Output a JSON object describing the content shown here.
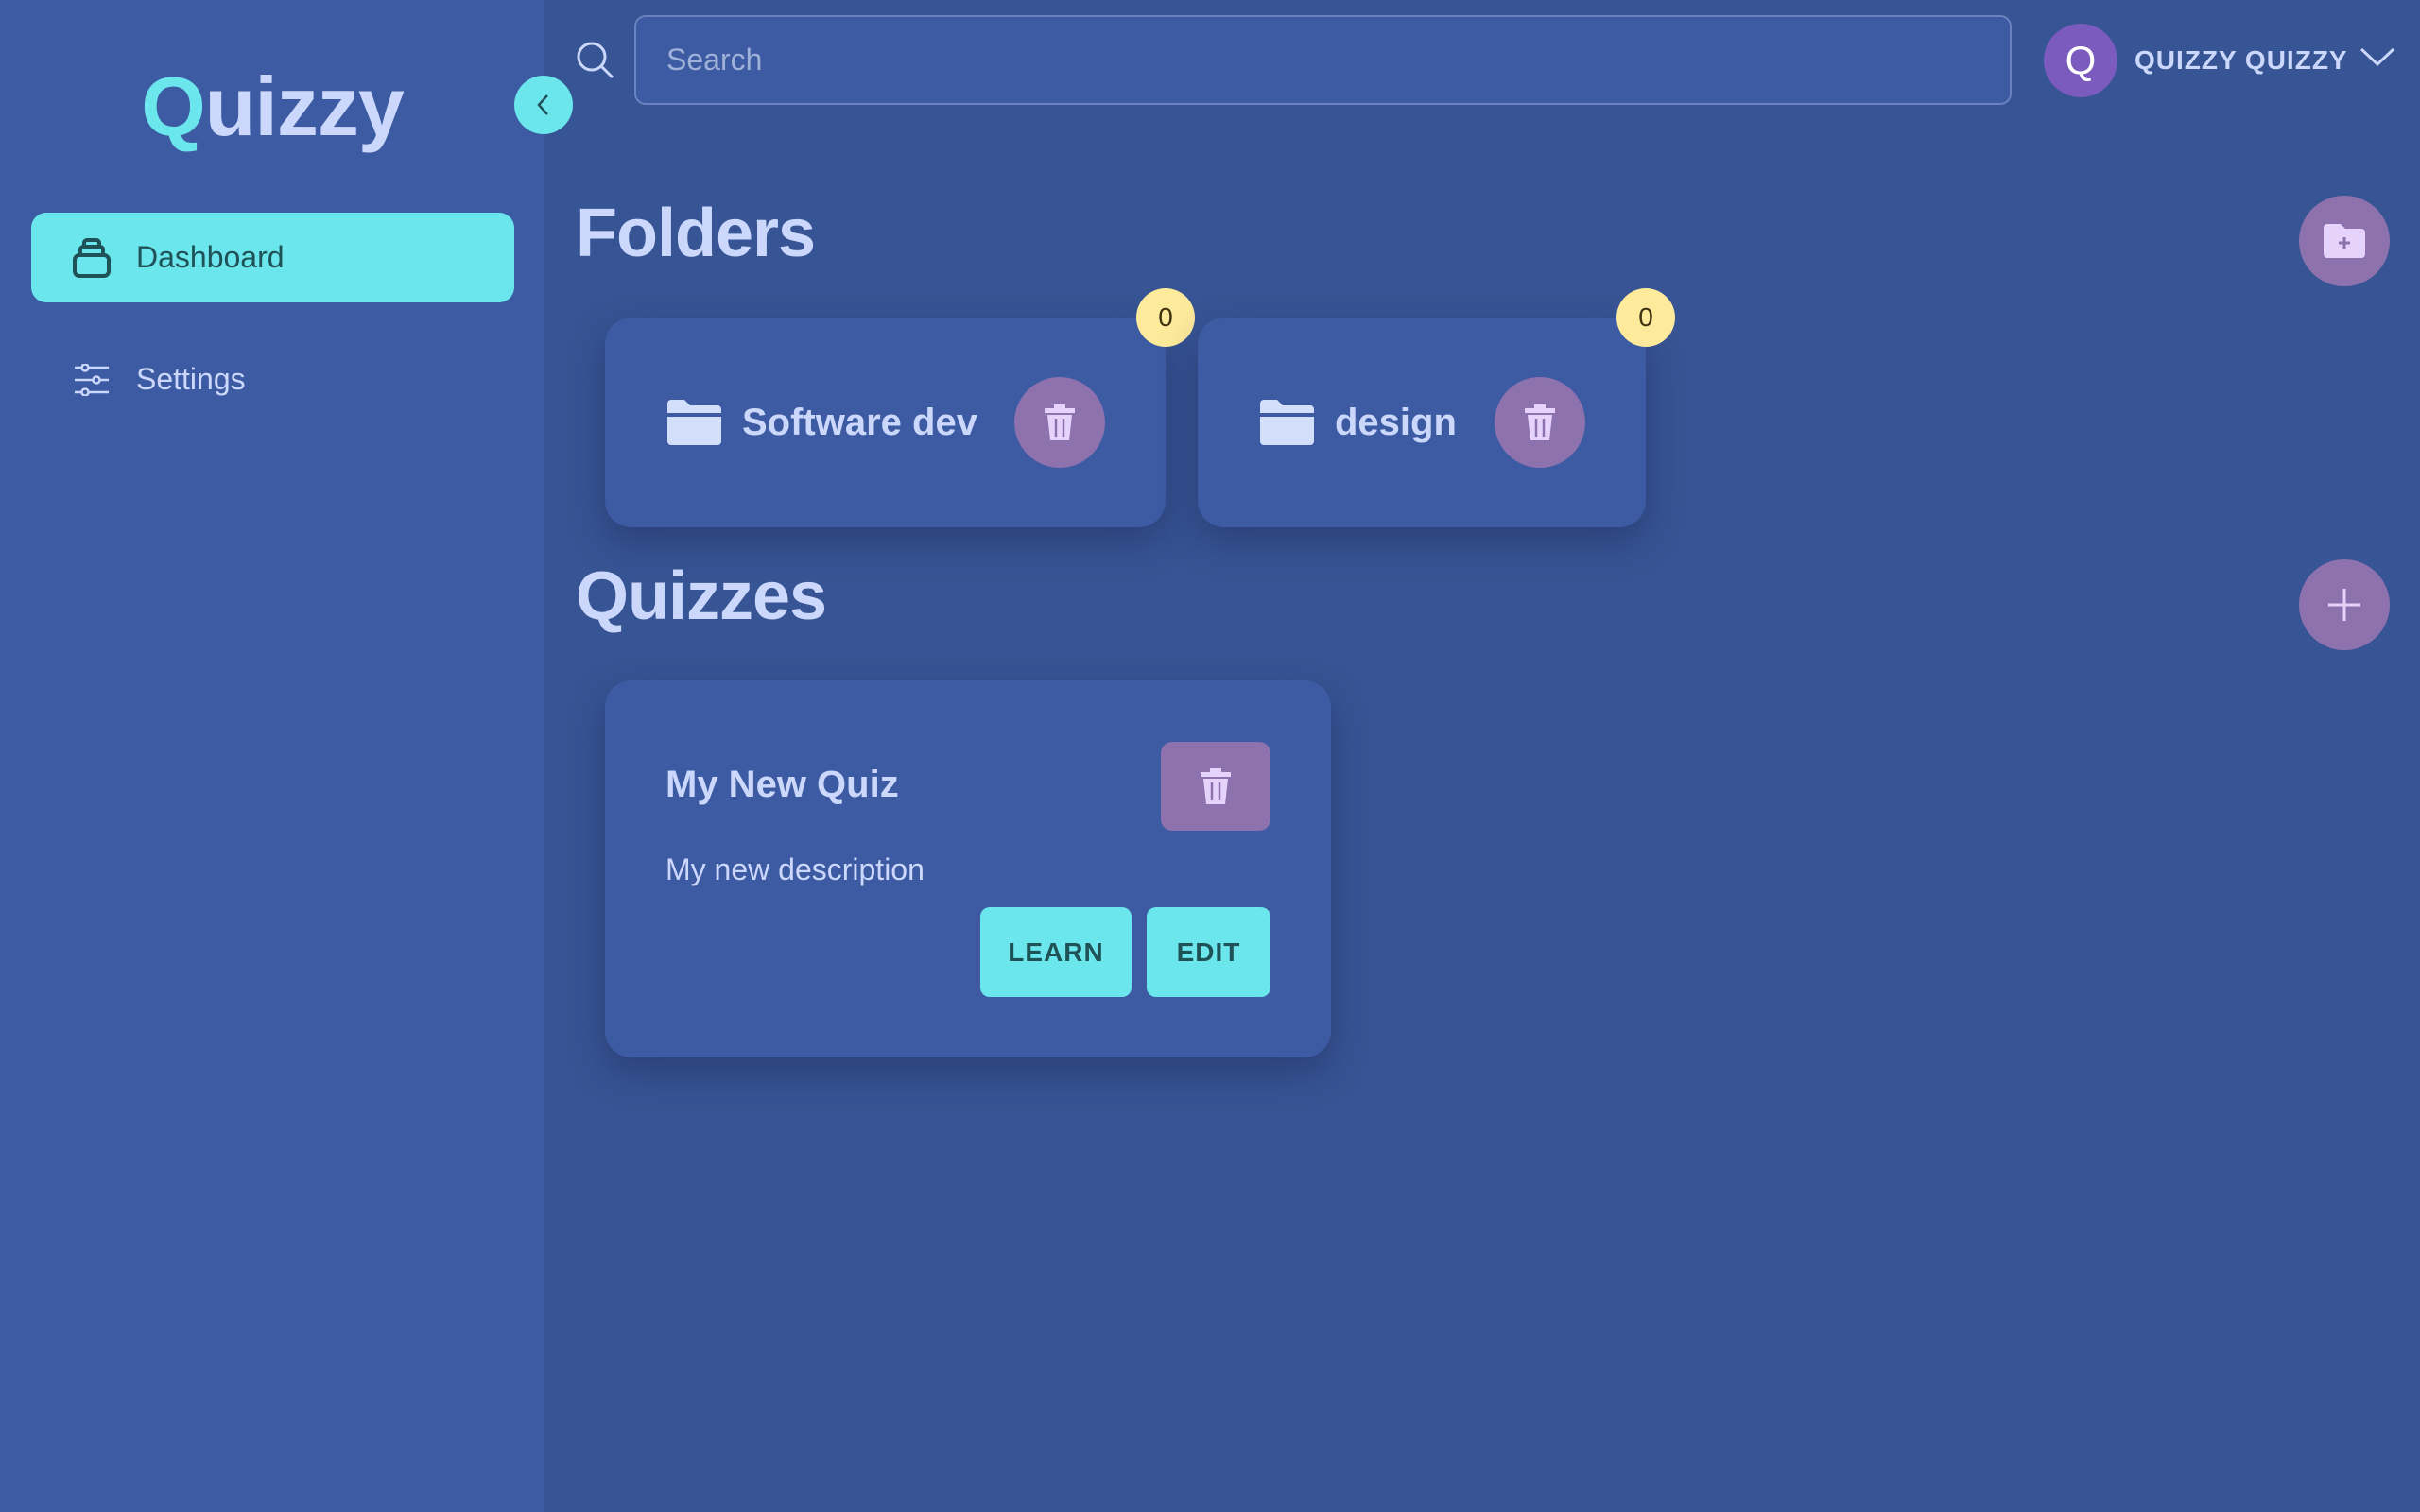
{
  "app": {
    "logo_first": "Q",
    "logo_rest": "uizzy"
  },
  "sidebar": {
    "items": [
      {
        "label": "Dashboard",
        "icon": "inbox-icon",
        "active": true
      },
      {
        "label": "Settings",
        "icon": "sliders-icon",
        "active": false
      }
    ]
  },
  "header": {
    "search_placeholder": "Search",
    "search_value": "",
    "user_initial": "Q",
    "user_name": "QUIZZY QUIZZY"
  },
  "folders": {
    "title": "Folders",
    "items": [
      {
        "name": "Software dev",
        "count": "0"
      },
      {
        "name": "design",
        "count": "0"
      }
    ]
  },
  "quizzes": {
    "title": "Quizzes",
    "items": [
      {
        "title": "My New Quiz",
        "description": "My new description",
        "learn_label": "LEARN",
        "edit_label": "EDIT"
      }
    ]
  },
  "colors": {
    "sidebar": "#3d5ba3",
    "main": "#375494",
    "accent": "#6be6ec",
    "purple": "#8d72ae",
    "badge": "#fdea9b"
  }
}
